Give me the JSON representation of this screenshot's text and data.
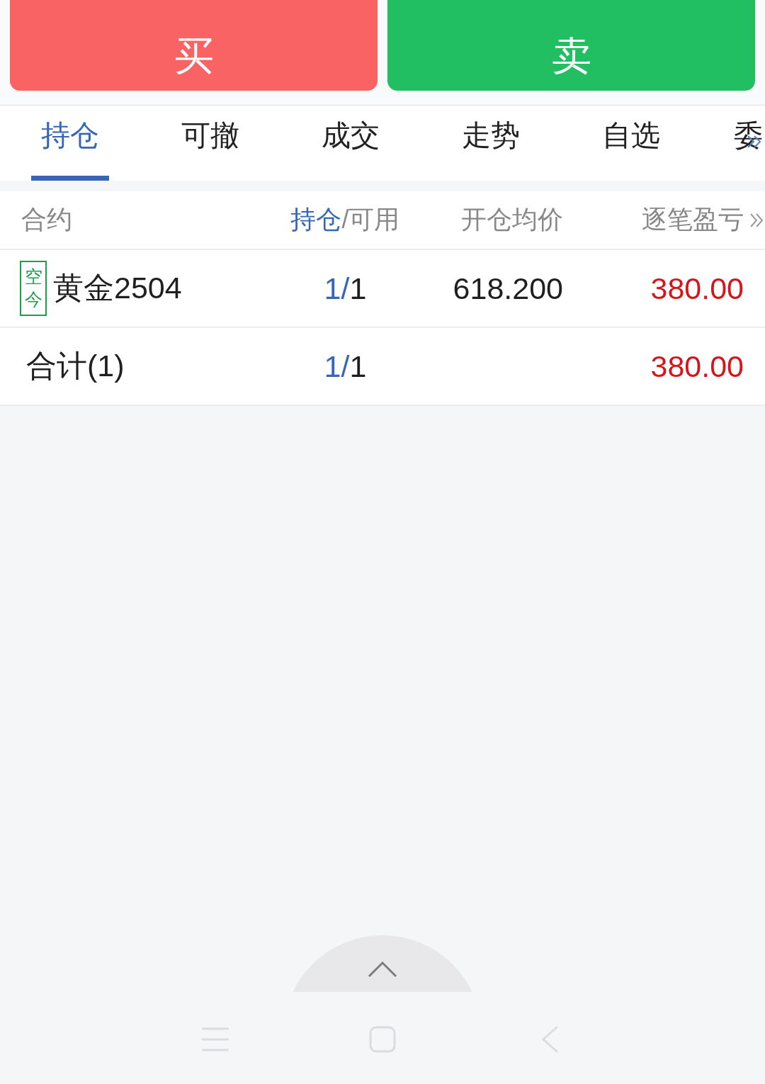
{
  "trade_buttons": [
    {
      "label": "买",
      "kind": "buy"
    },
    {
      "label": "卖",
      "kind": "sell"
    }
  ],
  "tabs": [
    {
      "label": "持仓",
      "selected": true
    },
    {
      "label": "可撤",
      "selected": false
    },
    {
      "label": "成交",
      "selected": false
    },
    {
      "label": "走势",
      "selected": false
    },
    {
      "label": "自选",
      "selected": false
    },
    {
      "label": "委",
      "selected": false
    }
  ],
  "table": {
    "columns": [
      {
        "parts": [
          {
            "text": "合约",
            "highlight": false
          }
        ]
      },
      {
        "parts": [
          {
            "text": "持仓",
            "highlight": true
          },
          {
            "text": "/可用",
            "highlight": false
          }
        ]
      },
      {
        "parts": [
          {
            "text": "开仓均价",
            "highlight": false
          }
        ]
      },
      {
        "parts": [
          {
            "text": "逐笔盈亏",
            "highlight": false
          }
        ]
      }
    ],
    "rows": [
      {
        "kind": "position",
        "tag": {
          "text": "空今",
          "color": "#1f9d4f"
        },
        "contract": "黄金2504",
        "position": [
          {
            "text": "1/",
            "highlight": true
          },
          {
            "text": "1",
            "highlight": false
          }
        ],
        "avg_price": "618.200",
        "pnl": "380.00",
        "pnl_up": true
      },
      {
        "kind": "total",
        "contract": "合计(1)",
        "position": [
          {
            "text": "1/",
            "highlight": true
          },
          {
            "text": "1",
            "highlight": false
          }
        ],
        "pnl": "380.00",
        "pnl_up": true
      }
    ]
  }
}
